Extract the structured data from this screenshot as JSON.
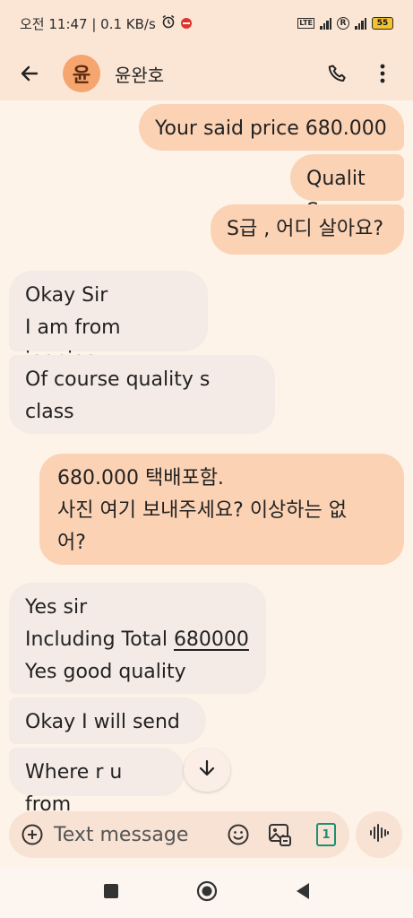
{
  "status_bar": {
    "time_speed": "오전 11:47 | 0.1 KB/s",
    "alarm_icon": "alarm-clock-icon",
    "dnd_icon": "do-not-disturb-icon",
    "volte": "LTE",
    "battery": "55"
  },
  "app_bar": {
    "avatar_initial": "윤",
    "contact_name": "윤완호",
    "avatar_color": "#f6a56e"
  },
  "messages": [
    {
      "direction": "outgoing",
      "text": "Your said price 680.000"
    },
    {
      "direction": "outgoing",
      "text": "Qualit S."
    },
    {
      "direction": "outgoing",
      "text": "S급 , 어디 살아요?"
    },
    {
      "direction": "incoming",
      "text": "Okay Sir\nI am from jeonjoo"
    },
    {
      "direction": "incoming",
      "text": "Of course quality s class"
    },
    {
      "direction": "outgoing",
      "text": "680.000 택배포함.\n사진 여기 보내주세요? 이상하는 없\n어?"
    },
    {
      "direction": "incoming",
      "line1": "Yes sir",
      "line2_prefix": "Including Total ",
      "line2_link": "680000",
      "line3": "Yes good quality"
    },
    {
      "direction": "incoming",
      "text": "Okay I will send u"
    },
    {
      "direction": "incoming",
      "text": "Where r u from"
    }
  ],
  "composer": {
    "placeholder": "Text message",
    "sim_number": "1"
  },
  "colors": {
    "outgoing_bubble": "#fbd2b4",
    "incoming_bubble": "#f5ebe6",
    "background": "#fdf3e8",
    "header": "#fbe6d6"
  }
}
